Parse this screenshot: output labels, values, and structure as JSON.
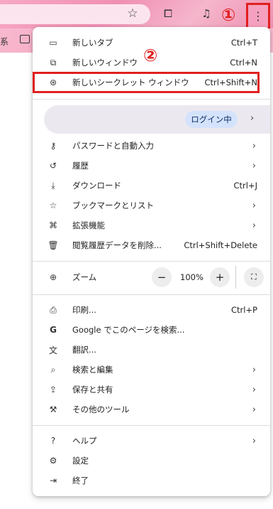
{
  "toolbar": {
    "bookmarks_text": "系",
    "icons": [
      "star-icon",
      "extension-icon",
      "media-icon",
      "kebab-menu-icon"
    ]
  },
  "annotations": {
    "one": "①",
    "two": "②"
  },
  "menu": {
    "section1": [
      {
        "icon": "new-tab-icon",
        "glyph": "▭",
        "label": "新しいタブ",
        "shortcut": "Ctrl+T"
      },
      {
        "icon": "new-window-icon",
        "glyph": "⧉",
        "label": "新しいウィンドウ",
        "shortcut": "Ctrl+N"
      },
      {
        "icon": "incognito-icon",
        "glyph": "⊛",
        "label": "新しいシークレット ウィンドウ",
        "shortcut": "Ctrl+Shift+N"
      }
    ],
    "profile": {
      "login_label": "ログイン中",
      "arrow": "›"
    },
    "section2": [
      {
        "icon": "key-icon",
        "glyph": "⚷",
        "label": "パスワードと自動入力",
        "arrow": "›"
      },
      {
        "icon": "history-icon",
        "glyph": "↺",
        "label": "履歴",
        "arrow": "›"
      },
      {
        "icon": "download-icon",
        "glyph": "⤓",
        "label": "ダウンロード",
        "shortcut": "Ctrl+J"
      },
      {
        "icon": "bookmark-star-icon",
        "glyph": "☆",
        "label": "ブックマークとリスト",
        "arrow": "›"
      },
      {
        "icon": "extensions-icon",
        "glyph": "⌘",
        "label": "拡張機能",
        "arrow": "›"
      },
      {
        "icon": "trash-icon",
        "glyph": "🗑",
        "label": "閲覧履歴データを削除...",
        "shortcut": "Ctrl+Shift+Delete"
      }
    ],
    "zoom": {
      "icon": "zoom-icon",
      "glyph": "⊕",
      "label": "ズーム",
      "minus": "−",
      "value": "100%",
      "plus": "+",
      "fullscreen": "⛶"
    },
    "section3": [
      {
        "icon": "print-icon",
        "glyph": "⎙",
        "label": "印刷...",
        "shortcut": "Ctrl+P"
      },
      {
        "icon": "google-icon",
        "glyph": "G",
        "label": "Google でこのページを検索..."
      },
      {
        "icon": "translate-icon",
        "glyph": "文",
        "label": "翻訳..."
      },
      {
        "icon": "find-edit-icon",
        "glyph": "⌕",
        "label": "検索と編集",
        "arrow": "›"
      },
      {
        "icon": "save-share-icon",
        "glyph": "⇪",
        "label": "保存と共有",
        "arrow": "›"
      },
      {
        "icon": "toolbox-icon",
        "glyph": "⚒",
        "label": "その他のツール",
        "arrow": "›"
      }
    ],
    "section4": [
      {
        "icon": "help-icon",
        "glyph": "?",
        "label": "ヘルプ",
        "arrow": "›"
      },
      {
        "icon": "settings-icon",
        "glyph": "⚙",
        "label": "設定"
      },
      {
        "icon": "exit-icon",
        "glyph": "⇥",
        "label": "終了"
      }
    ]
  },
  "colors": {
    "annotation_red": "#e0201f",
    "pill_blue": "#d4e3fb"
  }
}
